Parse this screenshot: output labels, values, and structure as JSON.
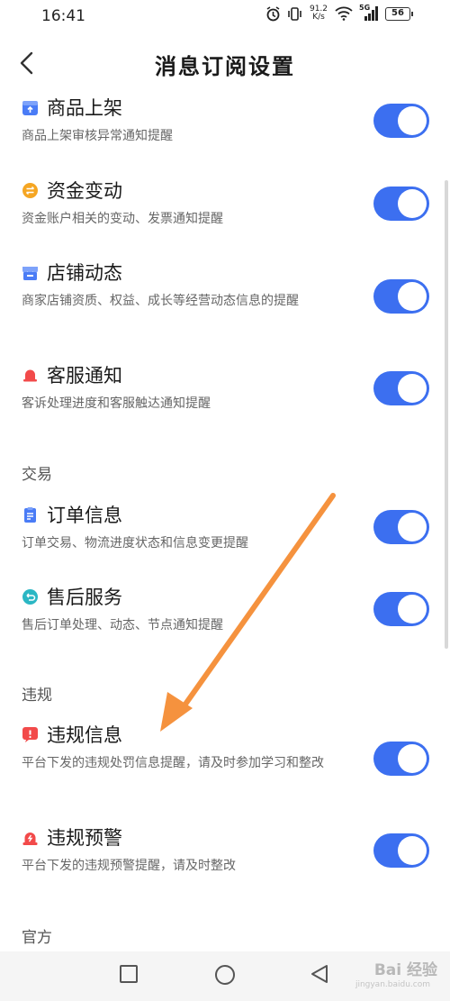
{
  "status_bar": {
    "time": "16:41",
    "net_speed_value": "91.2",
    "net_speed_unit": "K/s",
    "network_type": "5G",
    "battery": "56"
  },
  "header": {
    "title": "消息订阅设置"
  },
  "items": [
    {
      "title": "商品上架",
      "desc": "商品上架审核异常通知提醒",
      "icon": "product-icon",
      "icon_color": "#4a7cf6",
      "enabled": true
    },
    {
      "title": "资金变动",
      "desc": "资金账户相关的变动、发票通知提醒",
      "icon": "money-icon",
      "icon_color": "#f5a623",
      "enabled": true
    },
    {
      "title": "店铺动态",
      "desc": "商家店铺资质、权益、成长等经营动态信息的提醒",
      "icon": "store-icon",
      "icon_color": "#4a7cf6",
      "enabled": true
    },
    {
      "title": "客服通知",
      "desc": "客诉处理进度和客服触达通知提醒",
      "icon": "bell-icon",
      "icon_color": "#f24a4a",
      "enabled": true
    },
    {
      "title": "订单信息",
      "desc": "订单交易、物流进度状态和信息变更提醒",
      "icon": "clipboard-icon",
      "icon_color": "#4a7cf6",
      "enabled": true
    },
    {
      "title": "售后服务",
      "desc": "售后订单处理、动态、节点通知提醒",
      "icon": "return-icon",
      "icon_color": "#2bb7c4",
      "enabled": true
    },
    {
      "title": "违规信息",
      "desc": "平台下发的违规处罚信息提醒，请及时参加学习和整改",
      "icon": "alert-icon",
      "icon_color": "#f24a4a",
      "enabled": true
    },
    {
      "title": "违规预警",
      "desc": "平台下发的违规预警提醒，请及时整改",
      "icon": "siren-icon",
      "icon_color": "#f24a4a",
      "enabled": true
    }
  ],
  "sections": {
    "trade": "交易",
    "violation": "违规",
    "official": "官方"
  },
  "watermark": {
    "text": "Bai 经验",
    "sub": "jingyan.baidu.com"
  },
  "colors": {
    "toggle_on": "#3c6ff0",
    "arrow": "#f5923e"
  }
}
